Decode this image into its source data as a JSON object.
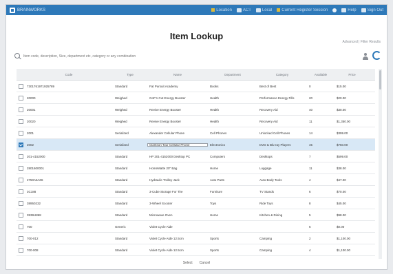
{
  "window": {
    "app_title": "BRAINWORKS",
    "toolbar_items": [
      {
        "label": "Location",
        "icon": "warning-icon"
      },
      {
        "label": "ACT",
        "icon": "square-icon"
      },
      {
        "label": "Local",
        "icon": "checkbox-icon"
      },
      {
        "label": "Current Register Session",
        "icon": "register-icon"
      },
      {
        "label": "",
        "icon": "alert-icon"
      },
      {
        "label": "Help",
        "icon": "help-icon"
      },
      {
        "label": "Sign Out",
        "icon": "signout-icon"
      }
    ],
    "accent": "#2e79b9"
  },
  "page": {
    "title": "Item Lookup",
    "sublinks": "Advanced  |  Filter Results"
  },
  "search": {
    "placeholder": "Item code, description, Size, department etc, category or any combination",
    "value": ""
  },
  "table": {
    "columns": [
      "Code",
      "Type",
      "Name",
      "Department",
      "Category",
      "Available",
      "Price"
    ],
    "rows": [
      {
        "checked": false,
        "code": "7301761971925789",
        "type": "Standard",
        "name": "Fat Pursuit Academy",
        "department": "Books",
        "category": "Best of Best",
        "available": "0",
        "price": "$15.00"
      },
      {
        "checked": false,
        "code": "20000",
        "type": "Weighed",
        "name": "GoF'n Cut Energy Booster",
        "department": "Health",
        "category": "Performance Energy Fills",
        "available": "20",
        "price": "$20.00"
      },
      {
        "checked": false,
        "code": "20001",
        "type": "Weighed",
        "name": "Revive Energy Booster",
        "department": "Health",
        "category": "Recovery Aid",
        "available": "40",
        "price": "$30.00"
      },
      {
        "checked": false,
        "code": "20020",
        "type": "Weighed",
        "name": "Revive Energy Booster",
        "department": "Health",
        "category": "Recovery Aid",
        "available": "11",
        "price": "$1,350.00"
      },
      {
        "checked": false,
        "code": "2001",
        "type": "Serialized",
        "name": "Alexander Cellular Phone",
        "department": "Cell Phones",
        "category": "Unlocked Cell Phones",
        "available": "14",
        "price": "$399.00"
      },
      {
        "checked": true,
        "code": "2002",
        "type": "Serialized",
        "name": "Clarkson Tour Cellular Phone",
        "department": "Electronics",
        "category": "DVD & Blu-ray Players",
        "available": "45",
        "price": "$750.00",
        "focus_name": true
      },
      {
        "checked": false,
        "code": "201-4152000",
        "type": "Standard",
        "name": "HP 201-4152000 Desktop PC",
        "department": "Computers",
        "category": "Desktops",
        "available": "7",
        "price": "$599.00"
      },
      {
        "checked": false,
        "code": "2801600001",
        "type": "Standard",
        "name": "HomeMatte 20\" Bag",
        "department": "Home",
        "category": "Luggage",
        "available": "11",
        "price": "$38.00"
      },
      {
        "checked": false,
        "code": "2750A6A06",
        "type": "Standard",
        "name": "Hydraulic Trolley Jack",
        "department": "Auto Parts",
        "category": "Auto Body Tools",
        "available": "4",
        "price": "$47.00"
      },
      {
        "checked": false,
        "code": "3C188",
        "type": "Standard",
        "name": "3-Cube Storage For Tire",
        "department": "Furniture",
        "category": "TV Stands",
        "available": "6",
        "price": "$70.00"
      },
      {
        "checked": false,
        "code": "38950232",
        "type": "Standard",
        "name": "3-Wheel Scooter",
        "department": "Toys",
        "category": "Ride Toys",
        "available": "8",
        "price": "$45.00"
      },
      {
        "checked": false,
        "code": "3539U868",
        "type": "Standard",
        "name": "Microwave Oven",
        "department": "Home",
        "category": "Kitchen & Dining",
        "available": "5",
        "price": "$98.00"
      },
      {
        "checked": false,
        "code": "700",
        "type": "Generic",
        "name": "Violet Cycle Aide",
        "department": "",
        "category": "",
        "available": "6",
        "price": "$0.00"
      },
      {
        "checked": false,
        "code": "700-012",
        "type": "Standard",
        "name": "Violet Cycle Aide 12.5cm",
        "department": "Sports",
        "category": "Camping",
        "available": "2",
        "price": "$1,100.00"
      },
      {
        "checked": false,
        "code": "700-008",
        "type": "Standard",
        "name": "Violet Cycle Aide 12.5cm",
        "department": "Sports",
        "category": "Camping",
        "available": "4",
        "price": "$1,100.00"
      }
    ]
  },
  "footer": {
    "select_label": "Select",
    "cancel_label": "Cancel"
  }
}
